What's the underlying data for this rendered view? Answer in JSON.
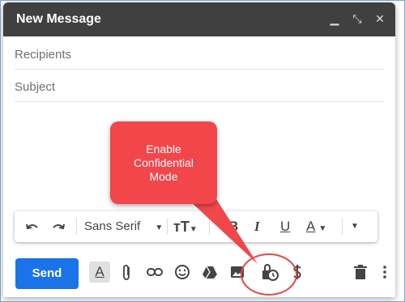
{
  "window": {
    "title": "New Message"
  },
  "fields": {
    "recipients_placeholder": "Recipients",
    "subject_placeholder": "Subject"
  },
  "format_bar": {
    "font_name": "Sans Serif",
    "icons": [
      "undo-icon",
      "redo-icon",
      "font-dropdown",
      "text-size-icon",
      "bold-icon",
      "italic-icon",
      "underline-icon",
      "text-color-icon",
      "more-formatting-icon"
    ]
  },
  "bottom_bar": {
    "send_label": "Send",
    "icons": [
      "formatting-options-icon",
      "attach-icon",
      "link-icon",
      "emoji-icon",
      "drive-icon",
      "photo-icon",
      "confidential-mode-icon",
      "signature-icon",
      "delete-icon",
      "more-options-icon"
    ]
  },
  "callout": {
    "lines": [
      "Enable",
      "Confidential",
      "Mode"
    ]
  },
  "colors": {
    "titlebar": "#404040",
    "send": "#1a73e8",
    "callout": "#f2464b",
    "frame": "#7aa7d6"
  }
}
